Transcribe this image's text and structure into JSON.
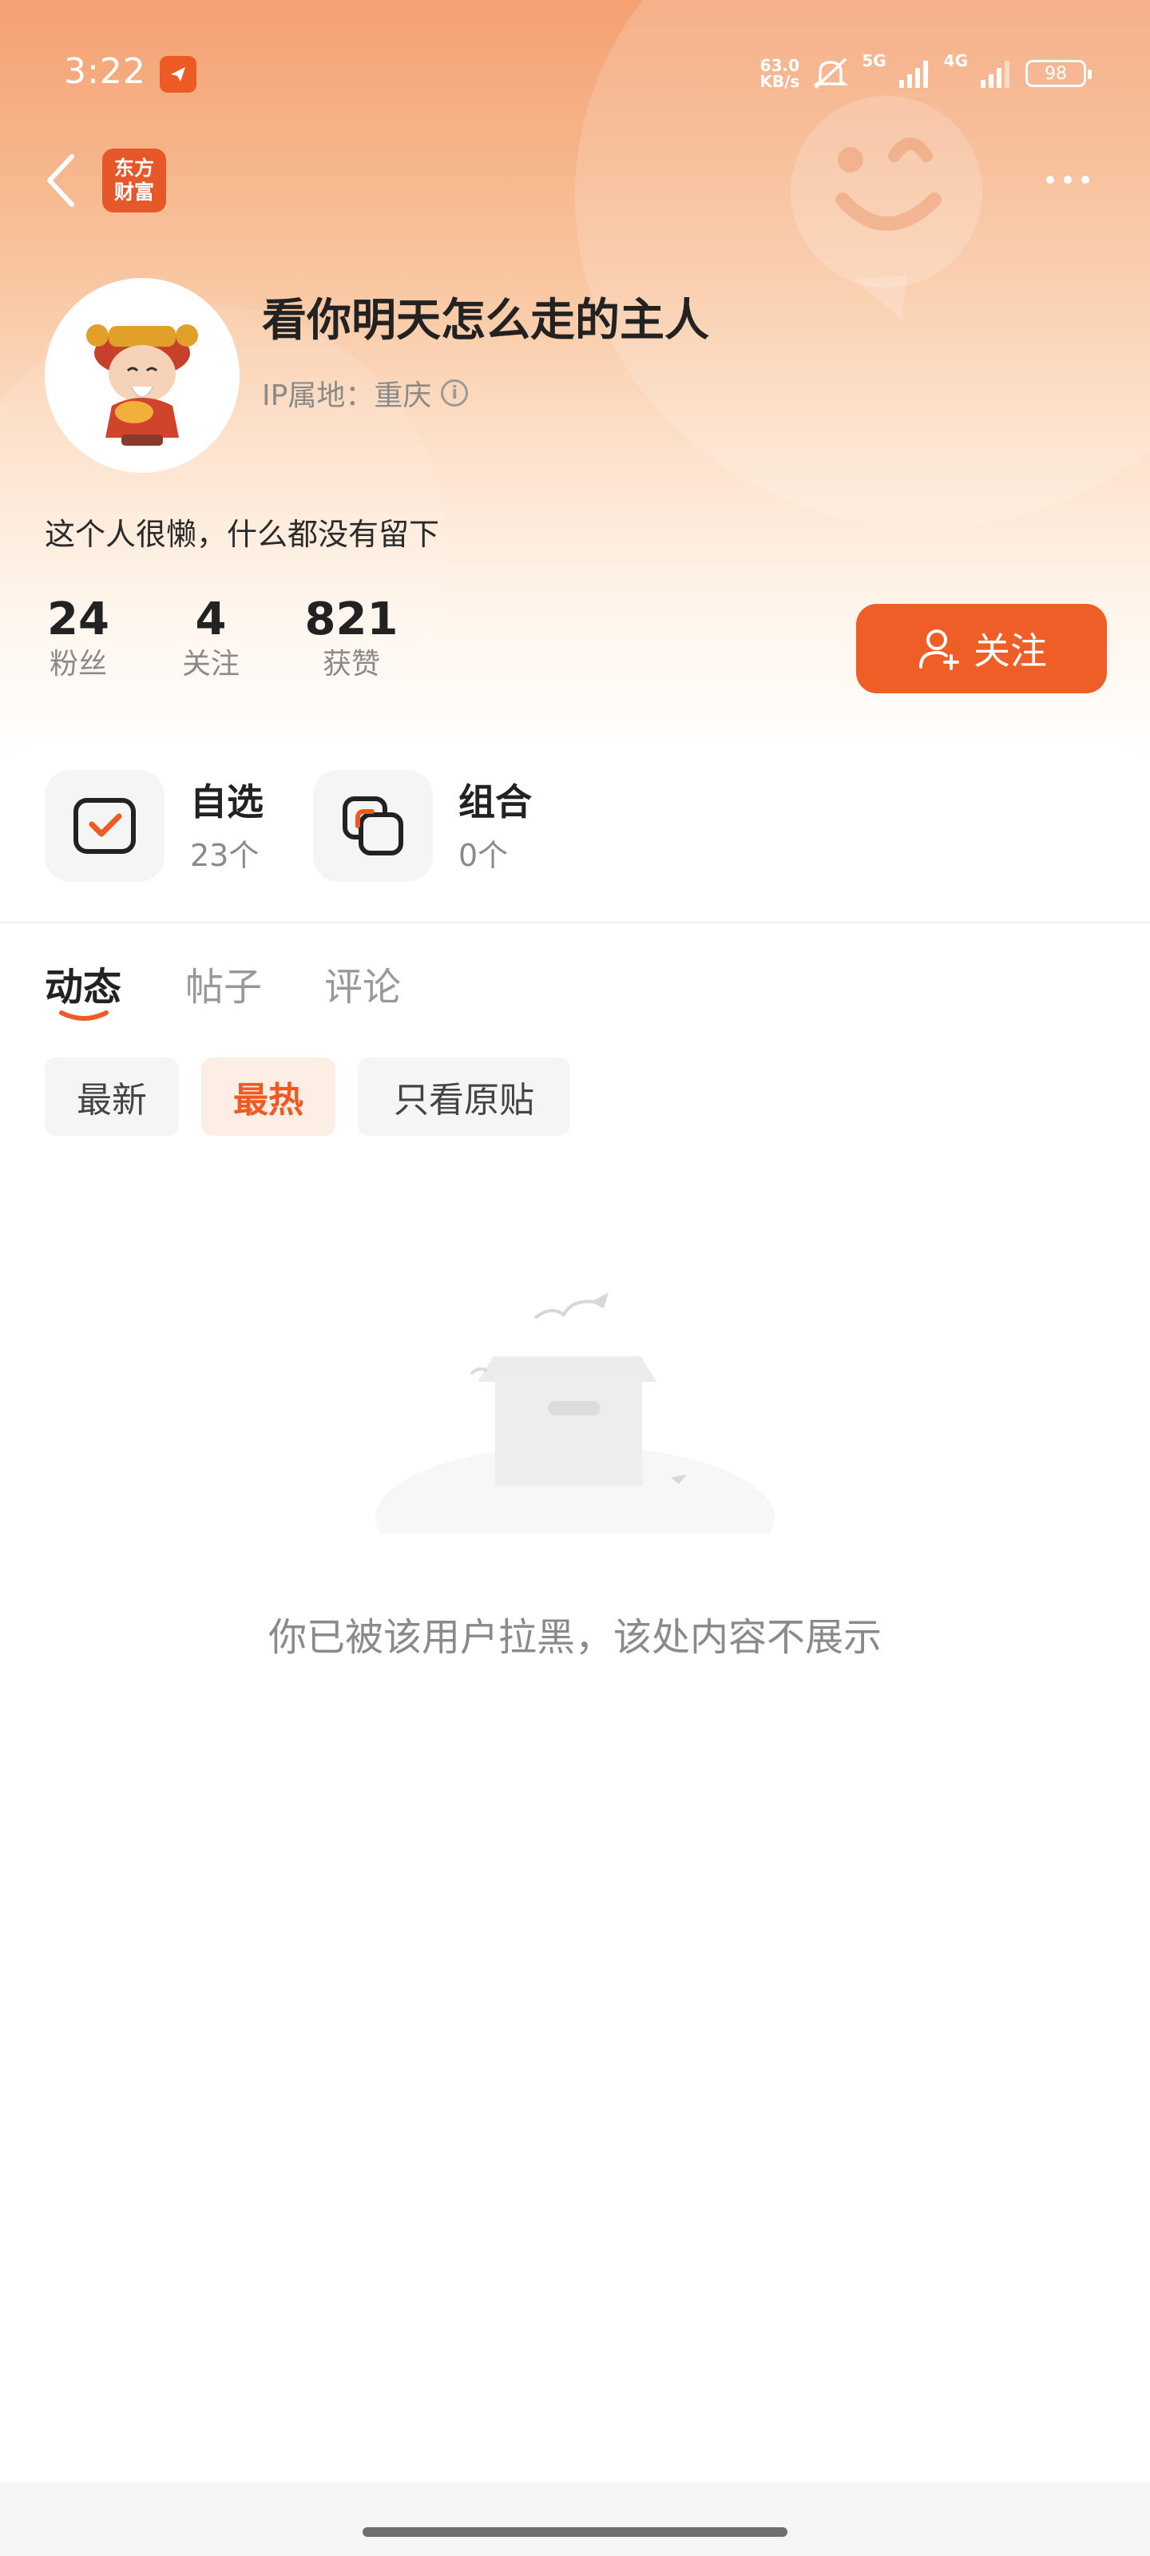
{
  "status_bar": {
    "time": "3:22",
    "net_speed_value": "63.0",
    "net_speed_unit": "KB/s",
    "signal_1": "5G",
    "signal_2": "4G",
    "battery": "98"
  },
  "header": {
    "brand_line1": "东方",
    "brand_line2": "财富"
  },
  "profile": {
    "username": "看你明天怎么走的主人",
    "ip_label": "IP属地：重庆",
    "bio": "这个人很懒，什么都没有留下",
    "stats": [
      {
        "value": "24",
        "label": "粉丝"
      },
      {
        "value": "4",
        "label": "关注"
      },
      {
        "value": "821",
        "label": "获赞"
      }
    ],
    "follow_label": "关注"
  },
  "shortcuts": [
    {
      "title": "自选",
      "sub": "23个"
    },
    {
      "title": "组合",
      "sub": "0个"
    }
  ],
  "tabs": [
    {
      "label": "动态",
      "active": true
    },
    {
      "label": "帖子",
      "active": false
    },
    {
      "label": "评论",
      "active": false
    }
  ],
  "filters": [
    {
      "label": "最新",
      "active": false
    },
    {
      "label": "最热",
      "active": true
    },
    {
      "label": "只看原贴",
      "active": false
    }
  ],
  "empty_message": "你已被该用户拉黑，该处内容不展示",
  "colors": {
    "accent": "#EE5E26",
    "muted_text": "#8A8A8A"
  }
}
